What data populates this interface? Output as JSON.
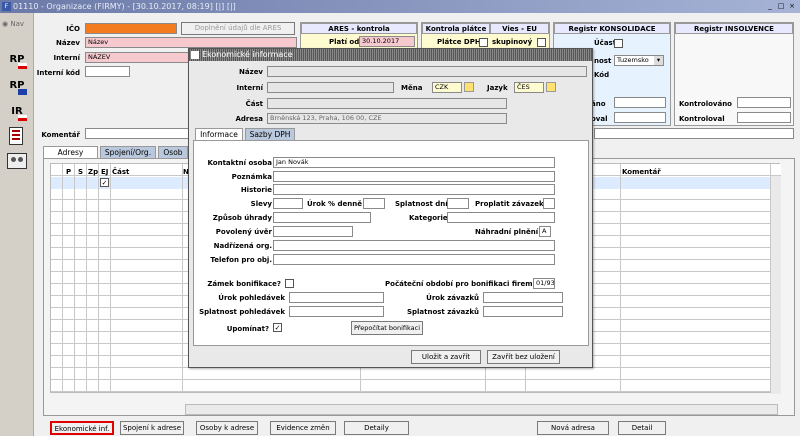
{
  "window": {
    "title": "01110 - Organizace (FIRMY) - [30.10.2017, 08:19] [|] [|]",
    "nav": "Nav",
    "icon_text": "F",
    "min": "_",
    "max": "□",
    "close": "×"
  },
  "sidebar": {
    "items": [
      "RP",
      "RP",
      "IR",
      "",
      ""
    ]
  },
  "form": {
    "ico_label": "IČO",
    "ico_value": "",
    "ares_btn": "Doplnění údajů dle ARES",
    "nazev_label": "Název",
    "nazev_value": "Název",
    "interni_label": "Interní",
    "interni_value": "NÁZEV",
    "interni_kod_label": "Interní kód",
    "interni_kod_value": "",
    "komentar_label": "Komentář",
    "komentar_value": ""
  },
  "ares": {
    "title": "ARES - kontrola",
    "plati_label": "Platí od",
    "plati_value": "30.10.2017"
  },
  "dph": {
    "title": "Kontrola plátce",
    "vies": "Vies - EU",
    "platce_label": "Plátce DPH",
    "skupinovy_label": "skupinový"
  },
  "konsolidace": {
    "title": "Registr KONSOLIDACE",
    "ucast_label": "Účast",
    "pusobnost_label": "nost",
    "pusobnost_value": "Tuzemsko",
    "kod_label": "Kód",
    "kontrolovano_label": "áno",
    "kontroloval_label": "oval"
  },
  "insolvence": {
    "title": "Registr INSOLVENCE",
    "kontrolovano_label": "Kontrolováno",
    "kontroloval_label": "Kontroloval"
  },
  "main_tabs": [
    "Adresy",
    "Spojení/Org.",
    "Osob"
  ],
  "grid": {
    "headers": [
      "P",
      "S",
      "Zp",
      "EJ",
      "Část",
      "N"
    ],
    "right_header": "Komentář"
  },
  "dialog": {
    "title": "Ekonomické informace",
    "nazev_label": "Název",
    "nazev_value": "",
    "interni_label": "Interní",
    "interni_value": "",
    "mena_label": "Měna",
    "mena_value": "CZK",
    "jazyk_label": "Jazyk",
    "jazyk_value": "ČES",
    "cast_label": "Část",
    "cast_value": "",
    "adresa_label": "Adresa",
    "adresa_value": "Brněnská 123, Praha, 106 00, CZE",
    "tabs": [
      "Informace",
      "Sazby DPH"
    ],
    "kontaktni_label": "Kontaktní osoba",
    "kontaktni_value": "Jan Novák",
    "poznamka_label": "Poznámka",
    "historie_label": "Historie",
    "slevy_label": "Slevy",
    "urok_denne_label": "Úrok % denně",
    "splatnost_dni_label": "Splatnost dní",
    "proplatit_label": "Proplatit závazek",
    "zpusob_label": "Způsob úhrady",
    "kategorie_label": "Kategorie",
    "povoleny_label": "Povolený úvěr",
    "nahradni_label": "Náhradní plnění",
    "nahradni_value": "A",
    "nadrizena_label": "Nadřízená org.",
    "telefon_label": "Telefon pro obj.",
    "zamek_label": "Zámek bonifikace?",
    "pocatecni_label": "Počáteční období pro bonifikaci firem",
    "pocatecni_value": "01/93",
    "urok_pohl_label": "Úrok pohledávek",
    "urok_zav_label": "Úrok závazků",
    "splat_pohl_label": "Splatnost pohledávek",
    "splat_zav_label": "Splatnost závazků",
    "upominat_label": "Upomínat?",
    "prepocitat_btn": "Přepočítat bonifikaci",
    "ulozit_btn": "Uložit a zavřít",
    "zavrit_btn": "Zavřít bez uložení"
  },
  "bottom_buttons": [
    "Ekonomické inf.",
    "Spojení k adrese",
    "Osoby k adrese",
    "Evidence změn",
    "Detaily",
    "Nová adresa",
    "Detail"
  ]
}
